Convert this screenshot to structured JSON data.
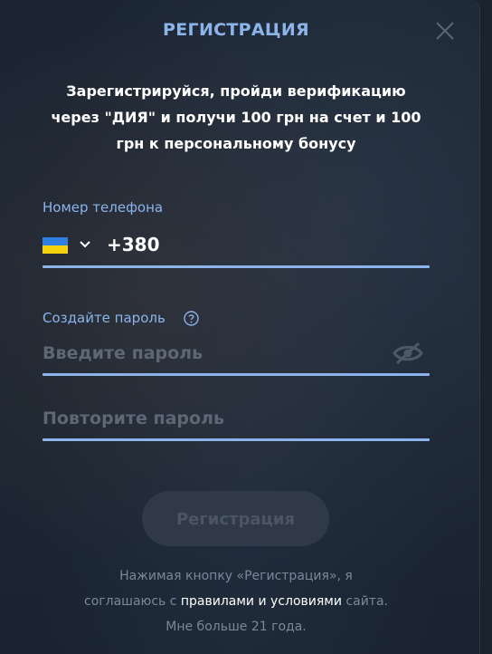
{
  "modal": {
    "title": "РЕГИСТРАЦИЯ",
    "close_icon": "close-icon"
  },
  "promo": {
    "line1": "Зарегистрируйся, пройди верификацию",
    "line2": "через \"ДИЯ\" и получи 100 грн на счет и 100",
    "line3": "грн к персональному бонусу"
  },
  "phone": {
    "label": "Номер телефона",
    "country_flag_icon": "ukraine-flag-icon",
    "dropdown_icon": "chevron-down-icon",
    "prefix": "+380",
    "underline_color": "#8cb4ea"
  },
  "password": {
    "label": "Создайте пароль",
    "help_icon": "question-circle-icon",
    "placeholder": "Введите пароль",
    "visibility_icon": "eye-off-icon"
  },
  "confirm_password": {
    "placeholder": "Повторите пароль"
  },
  "submit": {
    "label": "Регистрация",
    "state": "disabled"
  },
  "terms": {
    "prefix_line1": "Нажимая кнопку «Регистрация», я",
    "prefix_line2": "соглашаюсь с",
    "link_text": "правилами и условиями",
    "suffix_line2": "сайта.",
    "line3": "Мне больше 21 года."
  },
  "colors": {
    "accent": "#8cb4ea",
    "background": "#1e2836",
    "text": "#ffffff",
    "muted": "#7c8898",
    "placeholder": "#5d6776",
    "button_disabled_bg": "#2f3947",
    "button_disabled_text": "#4b5563"
  }
}
